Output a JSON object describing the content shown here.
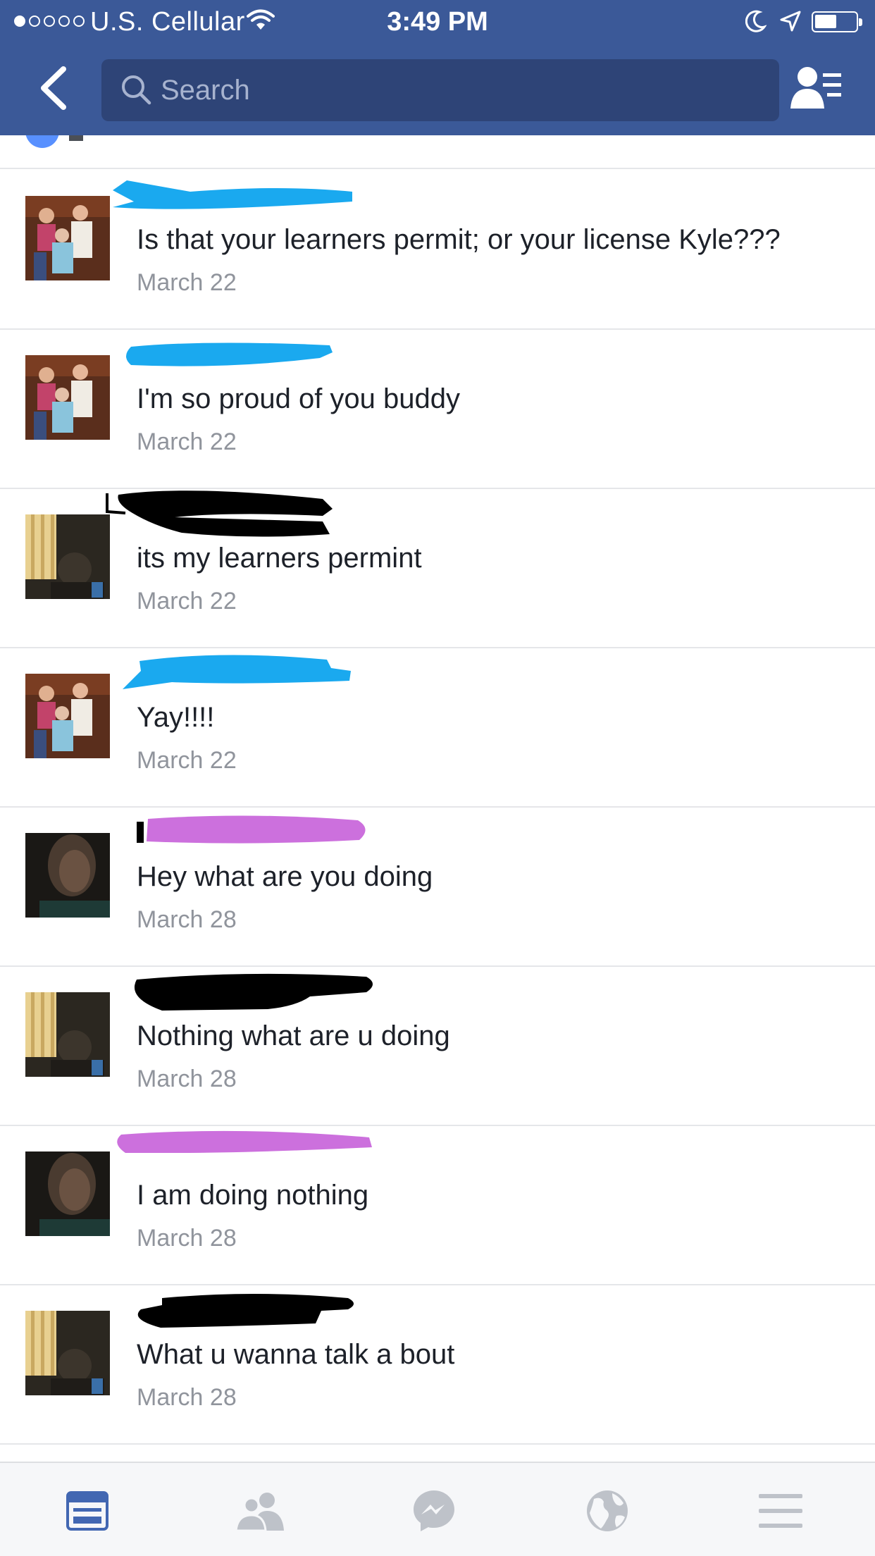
{
  "status_bar": {
    "carrier": "U.S. Cellular",
    "time": "3:49 PM"
  },
  "search": {
    "placeholder": "Search"
  },
  "colors": {
    "brand": "#3b5998",
    "search_bg": "#2e4477",
    "date_text": "#90949c",
    "active_tab": "#4267b2",
    "inactive_tab": "#bec2c9"
  },
  "comments": [
    {
      "text": "Is that your learners permit; or your license Kyle???",
      "date": "March 22",
      "avatar": "family-photo"
    },
    {
      "text": "I'm so proud of you buddy",
      "date": "March 22",
      "avatar": "family-photo"
    },
    {
      "text": "its my learners permint",
      "date": "March 22",
      "avatar": "selfie-dim"
    },
    {
      "text": "Yay!!!!",
      "date": "March 22",
      "avatar": "family-photo"
    },
    {
      "text": "Hey what are you doing",
      "date": "March 28",
      "avatar": "dark-portrait"
    },
    {
      "text": "Nothing what are u doing",
      "date": "March 28",
      "avatar": "selfie-dim"
    },
    {
      "text": "I am doing nothing",
      "date": "March 28",
      "avatar": "dark-portrait"
    },
    {
      "text": "What u wanna talk a bout",
      "date": "March 28",
      "avatar": "selfie-dim"
    }
  ],
  "tabs": [
    {
      "icon": "news-feed-icon",
      "active": true
    },
    {
      "icon": "friends-icon",
      "active": false
    },
    {
      "icon": "messenger-icon",
      "active": false
    },
    {
      "icon": "globe-icon",
      "active": false
    },
    {
      "icon": "menu-icon",
      "active": false
    }
  ]
}
